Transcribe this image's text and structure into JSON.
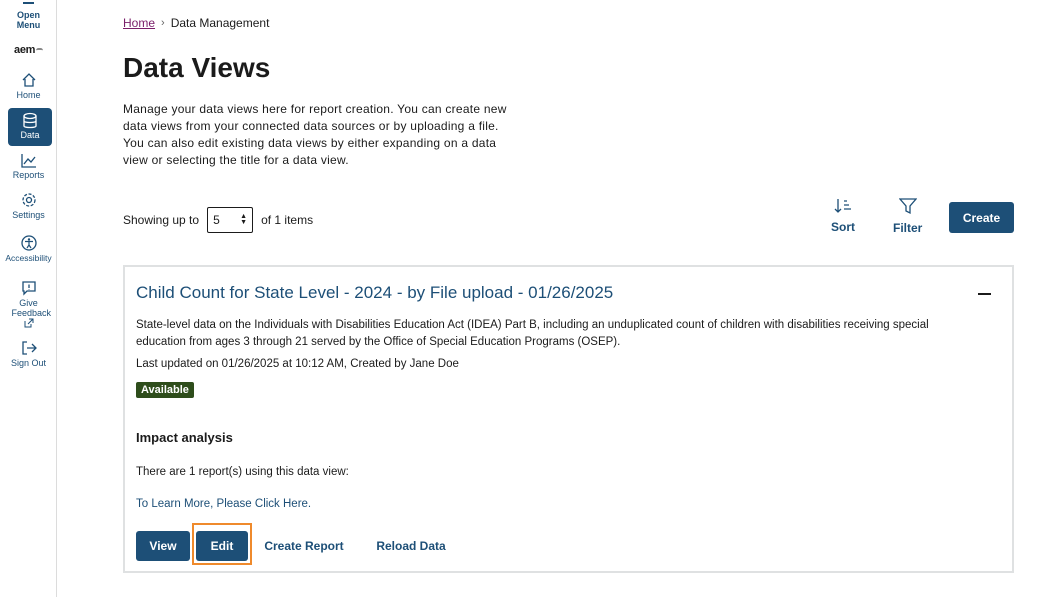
{
  "sidebar": {
    "menu_label": "Open Menu",
    "logo": "aem",
    "items": [
      {
        "label": "Home"
      },
      {
        "label": "Data"
      },
      {
        "label": "Reports"
      },
      {
        "label": "Settings"
      },
      {
        "label": "Accessibility"
      },
      {
        "label": "Give Feedback"
      },
      {
        "label": "Sign Out"
      }
    ]
  },
  "breadcrumb": {
    "home": "Home",
    "separator": "›",
    "current": "Data Management"
  },
  "page": {
    "title": "Data Views",
    "description": "Manage your data views here for report creation. You can create new data views from your connected data sources or by uploading a file. You can also edit existing data views by either expanding on a data view or selecting the title for a data view."
  },
  "listing": {
    "showing_prefix": "Showing up to",
    "page_size": "5",
    "showing_suffix": "of 1 items",
    "sort_label": "Sort",
    "filter_label": "Filter",
    "create_label": "Create"
  },
  "card": {
    "title": "Child Count for State Level - 2024 - by File upload - 01/26/2025",
    "description": "State-level data on the Individuals with Disabilities Education Act (IDEA) Part B, including an unduplicated count of children with disabilities receiving special education from ages 3 through 21 served by the Office of Special Education Programs (OSEP).",
    "updated": "Last updated on 01/26/2025 at 10:12 AM, Created by Jane Doe",
    "status": "Available",
    "impact_heading": "Impact analysis",
    "impact_text": "There are 1 report(s) using this data view:",
    "learn_more": "To Learn More, Please Click Here.",
    "actions": {
      "view": "View",
      "edit": "Edit",
      "create_report": "Create Report",
      "reload": "Reload Data"
    }
  },
  "colors": {
    "primary": "#1d4f77",
    "badge": "#2e4d1b",
    "highlight": "#ef8a2c",
    "breadcrumb_link": "#7a1e6a"
  }
}
